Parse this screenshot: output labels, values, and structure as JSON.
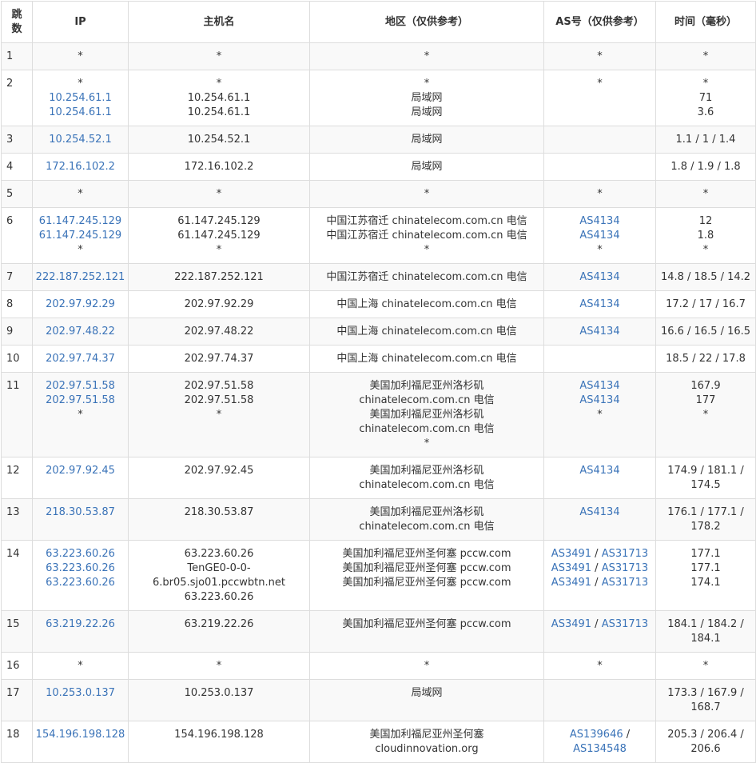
{
  "table": {
    "headers": {
      "hop": "跳数",
      "ip": "IP",
      "host": "主机名",
      "location": "地区（仅供参考）",
      "asn": "AS号（仅供参考）",
      "time": "时间（毫秒）"
    },
    "rows": [
      {
        "hop": "1",
        "ip": [
          "*"
        ],
        "host": [
          "*"
        ],
        "loc": [
          "*"
        ],
        "asn": [
          "*"
        ],
        "time": [
          "*"
        ]
      },
      {
        "hop": "2",
        "ip": [
          "*",
          "10.254.61.1",
          "10.254.61.1"
        ],
        "host": [
          "*",
          "10.254.61.1",
          "10.254.61.1"
        ],
        "loc": [
          "*",
          "局域网",
          "局域网"
        ],
        "asn": [
          "*"
        ],
        "time": [
          "*",
          "71",
          "3.6"
        ]
      },
      {
        "hop": "3",
        "ip": [
          "10.254.52.1"
        ],
        "host": [
          "10.254.52.1"
        ],
        "loc": [
          "局域网"
        ],
        "asn": [],
        "time": [
          "1.1 / 1 / 1.4"
        ]
      },
      {
        "hop": "4",
        "ip": [
          "172.16.102.2"
        ],
        "host": [
          "172.16.102.2"
        ],
        "loc": [
          "局域网"
        ],
        "asn": [],
        "time": [
          "1.8 / 1.9 / 1.8"
        ]
      },
      {
        "hop": "5",
        "ip": [
          "*"
        ],
        "host": [
          "*"
        ],
        "loc": [
          "*"
        ],
        "asn": [
          "*"
        ],
        "time": [
          "*"
        ]
      },
      {
        "hop": "6",
        "ip": [
          "61.147.245.129",
          "61.147.245.129",
          "*"
        ],
        "host": [
          "61.147.245.129",
          "61.147.245.129",
          "*"
        ],
        "loc": [
          "中国江苏宿迁 chinatelecom.com.cn 电信",
          "中国江苏宿迁 chinatelecom.com.cn 电信",
          "*"
        ],
        "asn": [
          "AS4134",
          "AS4134",
          "*"
        ],
        "time": [
          "12",
          "1.8",
          "*"
        ]
      },
      {
        "hop": "7",
        "ip": [
          "222.187.252.121"
        ],
        "host": [
          "222.187.252.121"
        ],
        "loc": [
          "中国江苏宿迁 chinatelecom.com.cn 电信"
        ],
        "asn": [
          "AS4134"
        ],
        "time": [
          "14.8 / 18.5 / 14.2"
        ]
      },
      {
        "hop": "8",
        "ip": [
          "202.97.92.29"
        ],
        "host": [
          "202.97.92.29"
        ],
        "loc": [
          "中国上海 chinatelecom.com.cn 电信"
        ],
        "asn": [
          "AS4134"
        ],
        "time": [
          "17.2 / 17 / 16.7"
        ]
      },
      {
        "hop": "9",
        "ip": [
          "202.97.48.22"
        ],
        "host": [
          "202.97.48.22"
        ],
        "loc": [
          "中国上海 chinatelecom.com.cn 电信"
        ],
        "asn": [
          "AS4134"
        ],
        "time": [
          "16.6 / 16.5 / 16.5"
        ]
      },
      {
        "hop": "10",
        "ip": [
          "202.97.74.37"
        ],
        "host": [
          "202.97.74.37"
        ],
        "loc": [
          "中国上海 chinatelecom.com.cn 电信"
        ],
        "asn": [],
        "time": [
          "18.5 / 22 / 17.8"
        ]
      },
      {
        "hop": "11",
        "ip": [
          "202.97.51.58",
          "202.97.51.58",
          "*"
        ],
        "host": [
          "202.97.51.58",
          "202.97.51.58",
          "*"
        ],
        "loc": [
          "美国加利福尼亚州洛杉矶",
          "chinatelecom.com.cn 电信",
          "美国加利福尼亚州洛杉矶",
          "chinatelecom.com.cn 电信",
          "*"
        ],
        "asn": [
          "AS4134",
          "AS4134",
          "*"
        ],
        "time": [
          "167.9",
          "177",
          "*"
        ]
      },
      {
        "hop": "12",
        "ip": [
          "202.97.92.45"
        ],
        "host": [
          "202.97.92.45"
        ],
        "loc": [
          "美国加利福尼亚州洛杉矶",
          "chinatelecom.com.cn 电信"
        ],
        "asn": [
          "AS4134"
        ],
        "time": [
          "174.9 / 181.1 /",
          "174.5"
        ]
      },
      {
        "hop": "13",
        "ip": [
          "218.30.53.87"
        ],
        "host": [
          "218.30.53.87"
        ],
        "loc": [
          "美国加利福尼亚州洛杉矶",
          "chinatelecom.com.cn 电信"
        ],
        "asn": [
          "AS4134"
        ],
        "time": [
          "176.1 / 177.1 /",
          "178.2"
        ]
      },
      {
        "hop": "14",
        "ip": [
          "63.223.60.26",
          "63.223.60.26",
          "63.223.60.26"
        ],
        "host": [
          "63.223.60.26",
          "TenGE0-0-0-",
          "6.br05.sjo01.pccwbtn.net",
          "63.223.60.26"
        ],
        "loc": [
          "美国加利福尼亚州圣何塞 pccw.com",
          "美国加利福尼亚州圣何塞 pccw.com",
          "美国加利福尼亚州圣何塞 pccw.com"
        ],
        "asn": [
          "AS3491 / AS31713",
          "AS3491 / AS31713",
          "AS3491 / AS31713"
        ],
        "time": [
          "177.1",
          "177.1",
          "174.1"
        ]
      },
      {
        "hop": "15",
        "ip": [
          "63.219.22.26"
        ],
        "host": [
          "63.219.22.26"
        ],
        "loc": [
          "美国加利福尼亚州圣何塞 pccw.com"
        ],
        "asn": [
          "AS3491 / AS31713"
        ],
        "time": [
          "184.1 / 184.2 /",
          "184.1"
        ]
      },
      {
        "hop": "16",
        "ip": [
          "*"
        ],
        "host": [
          "*"
        ],
        "loc": [
          "*"
        ],
        "asn": [
          "*"
        ],
        "time": [
          "*"
        ]
      },
      {
        "hop": "17",
        "ip": [
          "10.253.0.137"
        ],
        "host": [
          "10.253.0.137"
        ],
        "loc": [
          "局域网"
        ],
        "asn": [],
        "time": [
          "173.3 / 167.9 /",
          "168.7"
        ]
      },
      {
        "hop": "18",
        "ip": [
          "154.196.198.128"
        ],
        "host": [
          "154.196.198.128"
        ],
        "loc": [
          "美国加利福尼亚州圣何塞",
          "cloudinnovation.org"
        ],
        "asn": [
          "AS139646 /",
          "AS134548"
        ],
        "time": [
          "205.3 / 206.4 /",
          "206.6"
        ]
      }
    ]
  },
  "colors": {
    "link": "#3a73b8",
    "text": "#333333",
    "border": "#dddddd",
    "stripe": "#f9f9f9"
  }
}
